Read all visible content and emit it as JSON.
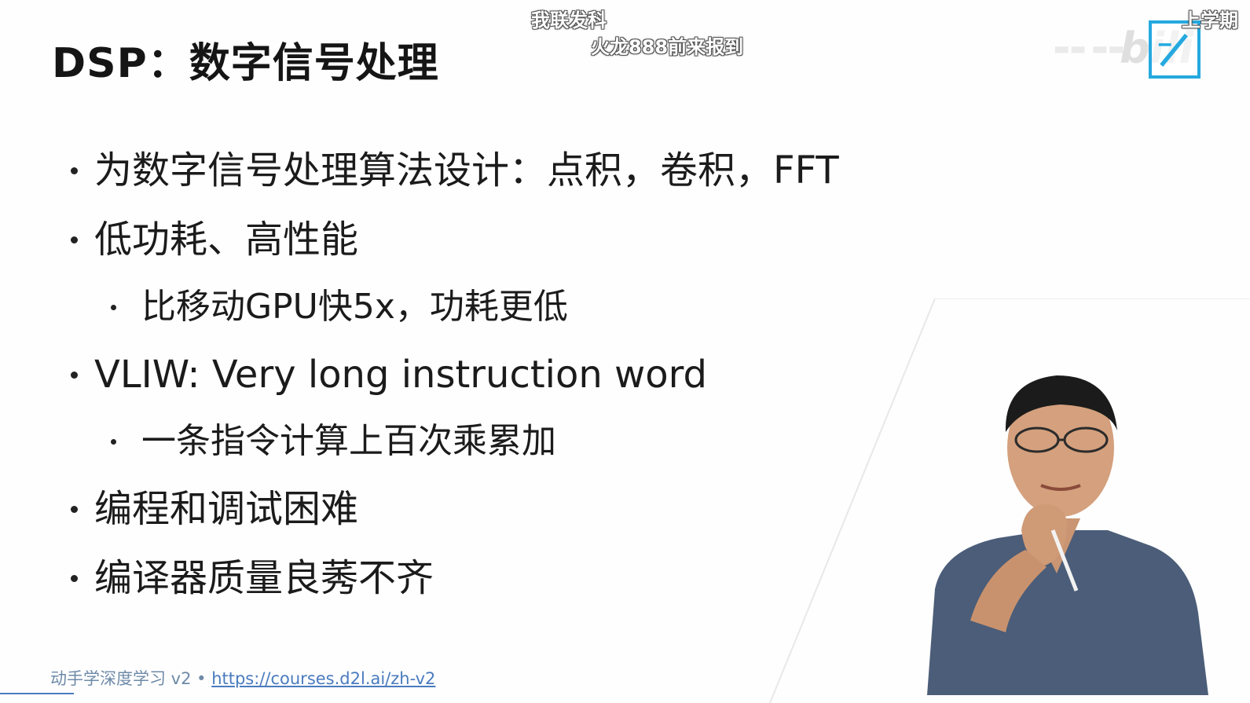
{
  "slide": {
    "title": "DSP：数字信号处理",
    "bullets": [
      {
        "level": 1,
        "text": "为数字信号处理算法设计：点积，卷积，FFT"
      },
      {
        "level": 1,
        "text": "低功耗、高性能"
      },
      {
        "level": 2,
        "text": "比移动GPU快5x，功耗更低"
      },
      {
        "level": 1,
        "text": "VLIW: Very long instruction word"
      },
      {
        "level": 2,
        "text": "一条指令计算上百次乘累加"
      },
      {
        "level": 1,
        "text": "编程和调试困难"
      },
      {
        "level": 1,
        "text": "编译器质量良莠不齐"
      }
    ],
    "footer": {
      "course": "动手学深度学习 v2 • ",
      "url": "https://courses.d2l.ai/zh-v2"
    }
  },
  "danmaku": {
    "comment_1": "我联发科",
    "comment_2": "火龙888前来报到",
    "comment_3": "上学期"
  },
  "colors": {
    "logo_blue": "#25a9df",
    "link": "#4a7bbf",
    "shirt": "#4b5d78"
  }
}
